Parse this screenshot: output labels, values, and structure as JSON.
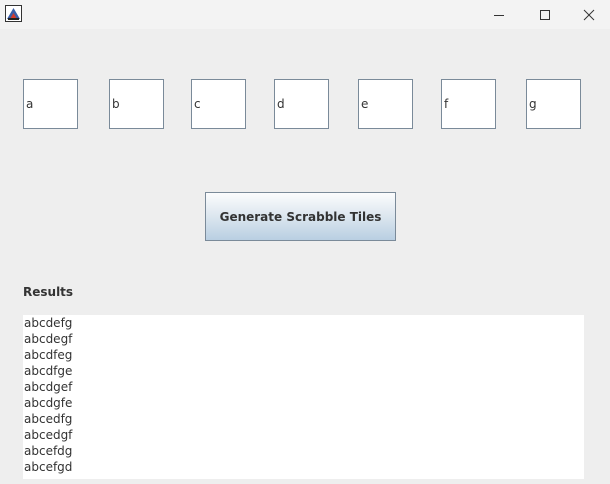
{
  "window": {
    "icon": "java-app-icon",
    "controls": [
      "minimize-icon",
      "maximize-icon",
      "close-icon"
    ]
  },
  "letters": [
    "a",
    "b",
    "c",
    "d",
    "e",
    "f",
    "g"
  ],
  "generate_button_label": "Generate Scrabble Tiles",
  "results_label": "Results",
  "results": [
    "abcdefg",
    "abcdegf",
    "abcdfeg",
    "abcdfge",
    "abcdgef",
    "abcdgfe",
    "abcedfg",
    "abcedgf",
    "abcefdg",
    "abcefgd"
  ]
}
